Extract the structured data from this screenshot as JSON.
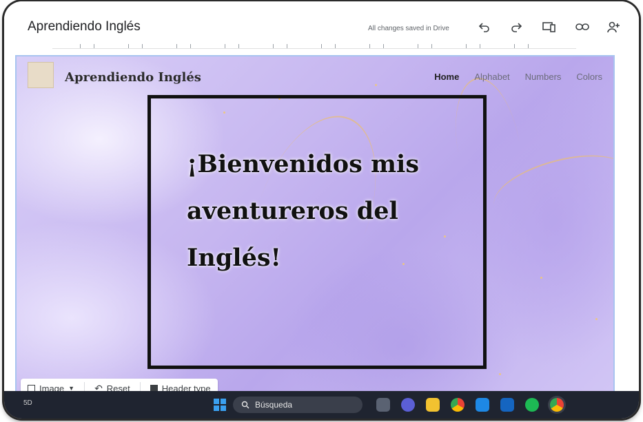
{
  "editor": {
    "doc_title": "Aprendiendo Inglés",
    "save_status": "All changes saved in Drive",
    "icons": [
      "undo-icon",
      "redo-icon",
      "preview-device-icon",
      "link-icon",
      "share-person-add-icon"
    ]
  },
  "site": {
    "title": "Aprendiendo Inglés",
    "logo_text": "",
    "nav": [
      "Home",
      "Alphabet",
      "Numbers",
      "Colors"
    ],
    "active_nav": "Home",
    "hero_line1": "¡Bienvenidos mis",
    "hero_line2": "aventureros del",
    "hero_line3": "Inglés!",
    "background_theme": "lavender watercolor"
  },
  "edit_tools": {
    "image_label": "Image",
    "reset_label": "Reset",
    "header_type_label": "Header type"
  },
  "taskbar": {
    "left_text": "5D",
    "search_placeholder": "Búsqueda",
    "apps": [
      "task-view-icon",
      "meet-icon",
      "file-explorer-icon",
      "chrome-icon",
      "mail-icon",
      "mail-alt-icon",
      "spotify-icon",
      "chrome-profile-icon"
    ]
  },
  "colors": {
    "hero_border": "#111111",
    "canvas_accent": "#b9a7ec",
    "selection_border": "#a8c4f0"
  }
}
